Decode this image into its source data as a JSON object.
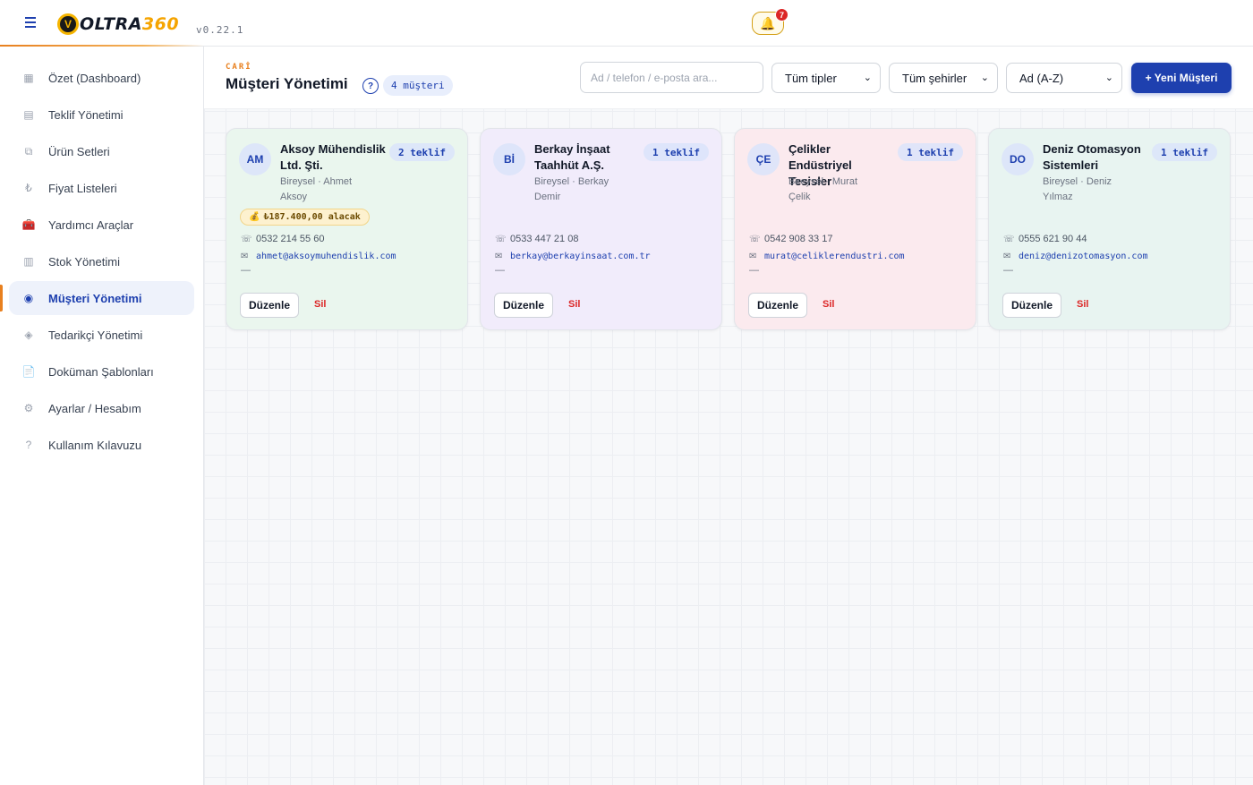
{
  "app": {
    "logo_text": "OLTRA",
    "logo_number": "360",
    "logo_mark": "V",
    "version": "v0.22.1",
    "notifications": {
      "icon": "bell-icon",
      "count": "7"
    }
  },
  "sidebar": {
    "items": [
      {
        "icon": "dashboard-icon",
        "glyph": "▦",
        "label": "Özet (Dashboard)"
      },
      {
        "icon": "offer-icon",
        "glyph": "▤",
        "label": "Teklif Yönetimi"
      },
      {
        "icon": "product-set-icon",
        "glyph": "⧉",
        "label": "Ürün Setleri"
      },
      {
        "icon": "lira-icon",
        "glyph": "₺",
        "label": "Fiyat Listeleri"
      },
      {
        "icon": "toolbox-icon",
        "glyph": "🧰",
        "label": "Yardımcı Araçlar"
      },
      {
        "icon": "stock-icon",
        "glyph": "▥",
        "label": "Stok Yönetimi"
      },
      {
        "icon": "customer-icon",
        "glyph": "◉",
        "label": "Müşteri Yönetimi",
        "active": true
      },
      {
        "icon": "supplier-icon",
        "glyph": "◈",
        "label": "Tedarikçi Yönetimi"
      },
      {
        "icon": "document-icon",
        "glyph": "📄",
        "label": "Doküman Şablonları"
      },
      {
        "icon": "settings-icon",
        "glyph": "⚙",
        "label": "Ayarlar / Hesabım"
      },
      {
        "icon": "help-icon",
        "glyph": "?",
        "label": "Kullanım Kılavuzu"
      }
    ]
  },
  "header": {
    "eyebrow": "CARİ",
    "title": "Müşteri Yönetimi",
    "help_glyph": "?",
    "count_badge": "4 müşteri",
    "search_placeholder": "Ad / telefon / e-posta ara...",
    "filter_type": "Tüm tipler",
    "filter_city": "Tüm şehirler",
    "sort": "Ad (A-Z)",
    "new_button": "+ Yeni Müşteri"
  },
  "customers": [
    {
      "initials": "AM",
      "name": "Aksoy Mühendislik Ltd. Şti.",
      "subtitle": "Bireysel · Ahmet Aksoy",
      "offers": "2 teklif",
      "receivable": "₺187.400,00 alacak",
      "phone": "0532 214 55 60",
      "email": "ahmet@aksoymuhendislik.com",
      "note": "—",
      "edit": "Düzenle",
      "delete": "Sil",
      "bg": "#eaf6ee"
    },
    {
      "initials": "Bİ",
      "name": "Berkay İnşaat Taahhüt A.Ş.",
      "subtitle": "Bireysel · Berkay Demir",
      "offers": "1 teklif",
      "receivable": "",
      "phone": "0533 447 21 08",
      "email": "berkay@berkayinsaat.com.tr",
      "note": "—",
      "edit": "Düzenle",
      "delete": "Sil",
      "bg": "#f1ecfb"
    },
    {
      "initials": "ÇE",
      "name": "Çelikler Endüstriyel Tesisler",
      "subtitle": "Bireysel · Murat Çelik",
      "offers": "1 teklif",
      "receivable": "",
      "phone": "0542 908 33 17",
      "email": "murat@celiklerendustri.com",
      "note": "—",
      "edit": "Düzenle",
      "delete": "Sil",
      "bg": "#fbeaee"
    },
    {
      "initials": "DO",
      "name": "Deniz Otomasyon Sistemleri",
      "subtitle": "Bireysel · Deniz Yılmaz",
      "offers": "1 teklif",
      "receivable": "",
      "phone": "0555 621 90 44",
      "email": "deniz@denizotomasyon.com",
      "note": "—",
      "edit": "Düzenle",
      "delete": "Sil",
      "bg": "#e8f4f1"
    }
  ],
  "icons": {
    "phone": "☏",
    "email": "✉",
    "money": "💰",
    "chevron": "⌄"
  },
  "colors": {
    "primary": "#1e40af",
    "accent": "#e8801f",
    "danger": "#dc2626"
  }
}
